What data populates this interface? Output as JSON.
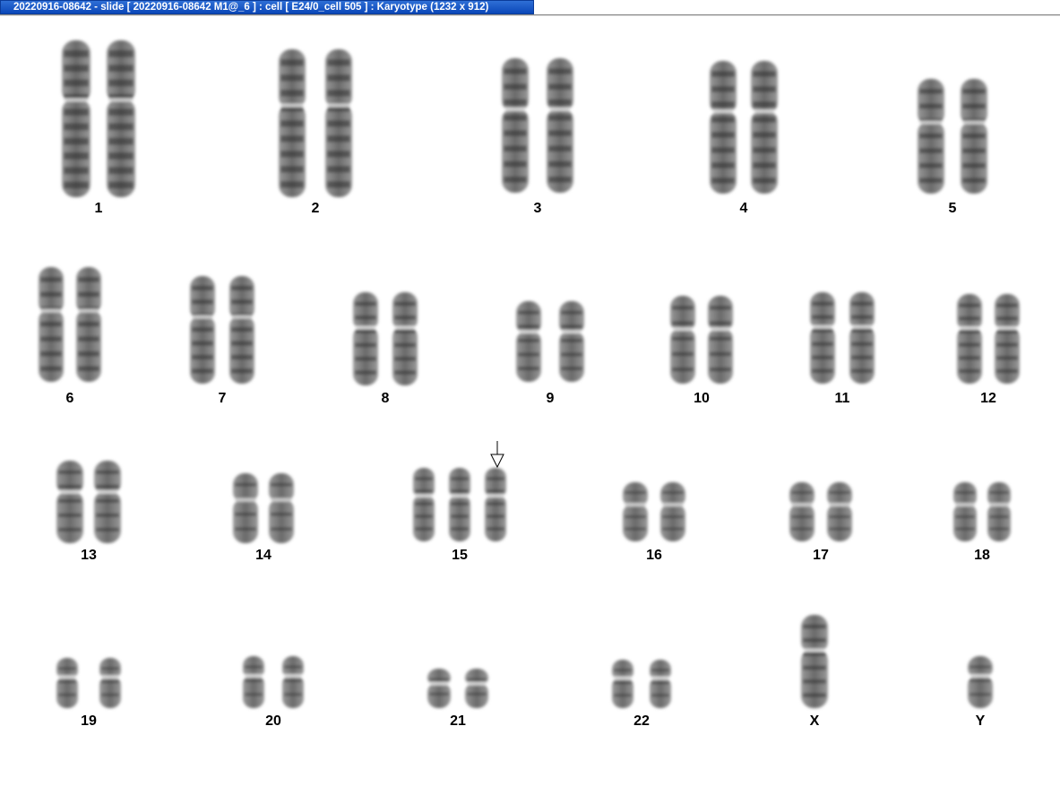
{
  "window": {
    "title": "20220916-08642 - slide [ 20220916-08642 M1@_6 ] : cell [ E24/0_cell 505 ] : Karyotype  (1232 x 912)"
  },
  "karyotype": {
    "groups": [
      {
        "label": "1",
        "count": 2
      },
      {
        "label": "2",
        "count": 2
      },
      {
        "label": "3",
        "count": 2
      },
      {
        "label": "4",
        "count": 2
      },
      {
        "label": "5",
        "count": 2
      },
      {
        "label": "6",
        "count": 2
      },
      {
        "label": "7",
        "count": 2
      },
      {
        "label": "8",
        "count": 2
      },
      {
        "label": "9",
        "count": 2
      },
      {
        "label": "10",
        "count": 2
      },
      {
        "label": "11",
        "count": 2
      },
      {
        "label": "12",
        "count": 2
      },
      {
        "label": "13",
        "count": 2
      },
      {
        "label": "14",
        "count": 2
      },
      {
        "label": "15",
        "count": 3
      },
      {
        "label": "16",
        "count": 2
      },
      {
        "label": "17",
        "count": 2
      },
      {
        "label": "18",
        "count": 2
      },
      {
        "label": "19",
        "count": 2
      },
      {
        "label": "20",
        "count": 2
      },
      {
        "label": "21",
        "count": 2
      },
      {
        "label": "22",
        "count": 2
      },
      {
        "label": "X",
        "count": 1
      },
      {
        "label": "Y",
        "count": 1
      }
    ],
    "marker": {
      "group": "15",
      "icon": "down-arrow-icon"
    }
  },
  "colors": {
    "titlebar": "#0a47b8",
    "title_text": "#ffffff",
    "background": "#ffffff",
    "chromosome": "#5a5a5a"
  }
}
